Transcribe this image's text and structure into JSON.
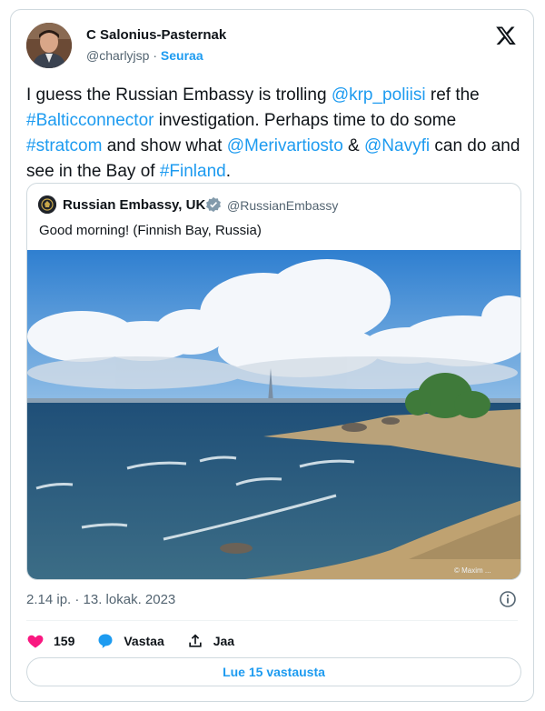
{
  "author": {
    "name": "C Salonius-Pasternak",
    "handle": "@charlyjsp",
    "separator": "·",
    "follow_label": "Seuraa"
  },
  "tweet": {
    "segments": [
      {
        "t": "I guess the Russian Embassy is trolling ",
        "link": false
      },
      {
        "t": "@krp_poliisi",
        "link": true
      },
      {
        "t": " ref the ",
        "link": false
      },
      {
        "t": "#Balticconnector",
        "link": true
      },
      {
        "t": " investigation. Perhaps time to do some ",
        "link": false
      },
      {
        "t": "#stratcom",
        "link": true
      },
      {
        "t": " and show what ",
        "link": false
      },
      {
        "t": "@Merivartiosto",
        "link": true
      },
      {
        "t": " & ",
        "link": false
      },
      {
        "t": "@Navyfi",
        "link": true
      },
      {
        "t": " can do and see in the Bay of ",
        "link": false
      },
      {
        "t": "#Finland",
        "link": true
      },
      {
        "t": ".",
        "link": false
      }
    ]
  },
  "quote": {
    "name": "Russian Embassy, UK",
    "handle": "@RussianEmbassy",
    "text": "Good morning! (Finnish Bay, Russia)",
    "watermark": "© Maxim ..."
  },
  "meta": {
    "timestamp": "2.14 ip. · 13. lokak. 2023"
  },
  "actions": {
    "likes": "159",
    "reply_label": "Vastaa",
    "share_label": "Jaa"
  },
  "replies_button": "Lue 15 vastausta",
  "colors": {
    "accent": "#1d9bf0",
    "like": "#f91880",
    "text": "#0f1419",
    "muted": "#536471"
  }
}
